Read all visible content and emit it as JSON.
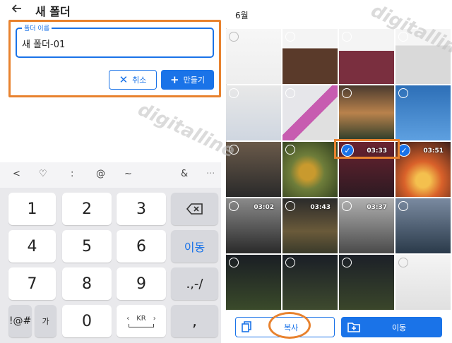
{
  "dialog": {
    "title": "새 폴더",
    "field_label": "폴더 이름",
    "field_value": "새 폴더-01",
    "cancel_label": "취소",
    "create_label": "만들기"
  },
  "keyboard": {
    "symbols": [
      "<",
      "♡",
      ":",
      "@",
      "~",
      "&",
      "···"
    ],
    "keys": {
      "k1": "1",
      "k2": "2",
      "k3": "3",
      "k4": "4",
      "k5": "5",
      "k6": "6",
      "k7": "7",
      "k8": "8",
      "k9": "9",
      "k0": "0",
      "symbol_key": "!@#",
      "hangul_key": "가",
      "lang_key": "KR",
      "move_key": "이동",
      "punct_key": ".,-/",
      "comma_key": ","
    }
  },
  "gallery": {
    "month": "6월",
    "durations": {
      "r3c3": "03:33",
      "r3c4": "03:51",
      "r4c1": "03:02",
      "r4c2": "03:43",
      "r4c3": "03:37"
    },
    "copy_label": "복사",
    "move_label": "이동"
  },
  "watermark": "digitalline",
  "colors": {
    "accent": "#1a73e8",
    "highlight": "#e8822e"
  }
}
